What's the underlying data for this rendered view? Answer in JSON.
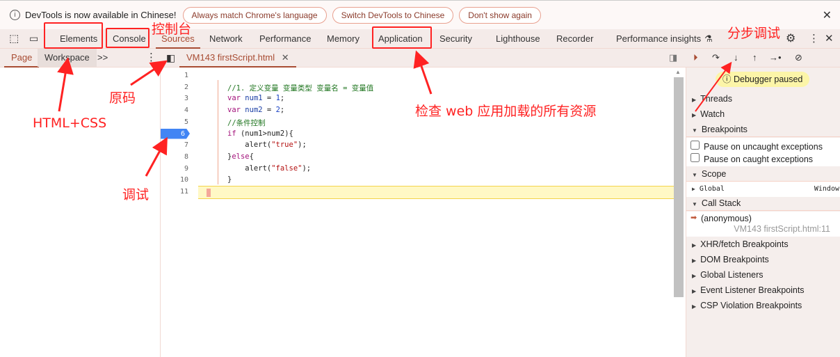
{
  "infobar": {
    "message": "DevTools is now available in Chinese!",
    "buttons": [
      "Always match Chrome's language",
      "Switch DevTools to Chinese",
      "Don't show again"
    ]
  },
  "tabs": [
    "Elements",
    "Console",
    "Sources",
    "Network",
    "Performance",
    "Memory",
    "Application",
    "Security",
    "Lighthouse",
    "Recorder",
    "Performance insights"
  ],
  "active_tab": "Sources",
  "navigator": {
    "tabs": [
      "Page",
      "Workspace"
    ],
    "more": ">>"
  },
  "editor": {
    "file_tab": "VM143 firstScript.html",
    "breakpoint_line": 6,
    "current_line": 11,
    "lines": [
      "",
      "//1. 定义变量 变量类型 变量名 = 变量值",
      "var num1 = 1;",
      "var num2 = 2;",
      "//条件控制",
      "if (num1>num2){",
      "    alert(\"true\");",
      "}else{",
      "    alert(\"false\");",
      "}",
      ""
    ]
  },
  "debugger": {
    "status": "Debugger paused",
    "sections": {
      "threads": "Threads",
      "watch": "Watch",
      "breakpoints": "Breakpoints",
      "scope": "Scope",
      "call_stack": "Call Stack"
    },
    "checkboxes": [
      {
        "label": "Pause on uncaught exceptions",
        "checked": false
      },
      {
        "label": "Pause on caught exceptions",
        "checked": false
      }
    ],
    "scope": {
      "name": "Global",
      "value": "Window"
    },
    "call_stack": {
      "frame": "(anonymous)",
      "location": "VM143 firstScript.html:11"
    },
    "more_sections": [
      "XHR/fetch Breakpoints",
      "DOM Breakpoints",
      "Global Listeners",
      "Event Listener Breakpoints",
      "CSP Violation Breakpoints"
    ]
  },
  "annotations": {
    "console": "控制台",
    "sources": "原码",
    "workspace": "HTML+CSS",
    "breakpoint": "调试",
    "application": "检查 web 应用加载的所有资源",
    "step": "分步调试"
  },
  "colors": {
    "accent": "#a84c33",
    "annotation": "#ff2222",
    "breakpoint": "#4285f4",
    "paused_line": "#fff8c5"
  }
}
